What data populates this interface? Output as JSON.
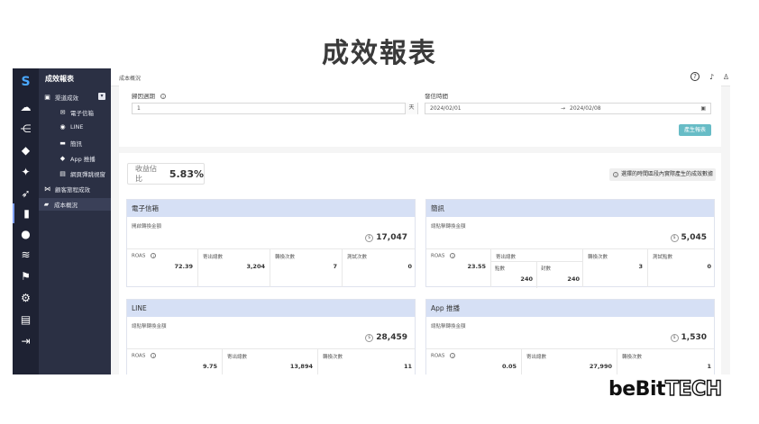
{
  "slide": {
    "title": "成效報表"
  },
  "brand": {
    "part1": "beBit",
    "part2": "TECH"
  },
  "rail": {
    "items": [
      "cloud-icon",
      "share-icon",
      "tag-icon",
      "magic-icon",
      "rocket-icon",
      "bar-chart-icon",
      "user-icon",
      "layers-icon",
      "flag-icon",
      "gear-icon",
      "book-icon",
      "exit-icon"
    ]
  },
  "sidebar": {
    "header": "成效報表",
    "items": [
      {
        "label": "渠道成效",
        "icon": "▣"
      },
      {
        "label": "電子信箱",
        "icon": "✉"
      },
      {
        "label": "LINE",
        "icon": "◉"
      },
      {
        "label": "簡訊",
        "icon": "▬"
      },
      {
        "label": "App 推播",
        "icon": "◆"
      },
      {
        "label": "網頁彈跳視窗",
        "icon": "▤"
      },
      {
        "label": "顧客旅程成效",
        "icon": "⋈"
      },
      {
        "label": "成本概況",
        "icon": "▰"
      }
    ]
  },
  "topbar": {
    "breadcrumb": "成本概況"
  },
  "filters": {
    "lookback_label": "歸因週期",
    "lookback_value": "1",
    "lookback_unit": "天",
    "period_label": "發信時間",
    "date_start": "2024/02/01",
    "date_sep": "→",
    "date_end": "2024/02/08",
    "generate_button": "產生報表"
  },
  "summary": {
    "roi_label": "收益佔比",
    "roi_value": "5.83%",
    "notice": "選擇的時間區段內實際產生的成效數據"
  },
  "cards": {
    "email": {
      "title": "電子信箱",
      "subtitle": "開啟轉換金額",
      "total": "17,047",
      "roas_label": "ROAS",
      "roas": "72.39",
      "sent_label": "寄出總數",
      "sent": "3,204",
      "conv_label": "轉換次數",
      "conv": "7",
      "test_label": "測試次數",
      "test": "0"
    },
    "sms": {
      "title": "簡訊",
      "subtitle": "總點擊轉換金額",
      "total": "5,045",
      "roas_label": "ROAS",
      "roas": "23.55",
      "sent_label": "寄出總數",
      "points_label": "點數",
      "points": "240",
      "count_label": "封數",
      "count": "240",
      "conv_label": "轉換次數",
      "conv": "3",
      "test_label": "測試點數",
      "test": "0"
    },
    "line": {
      "title": "LINE",
      "subtitle": "總點擊轉換金額",
      "total": "28,459",
      "roas_label": "ROAS",
      "roas": "9.75",
      "sent_label": "寄出總數",
      "sent": "13,894",
      "conv_label": "轉換次數",
      "conv": "11"
    },
    "app": {
      "title": "App 推播",
      "subtitle": "總點擊轉換金額",
      "total": "1,530",
      "roas_label": "ROAS",
      "roas": "0.05",
      "sent_label": "寄出總數",
      "sent": "27,990",
      "conv_label": "轉換次數",
      "conv": "1"
    }
  }
}
